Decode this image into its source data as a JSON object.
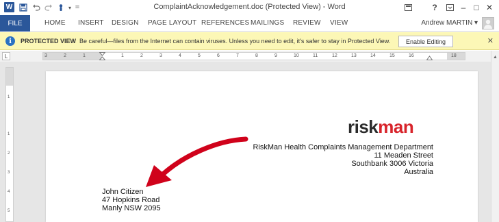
{
  "window": {
    "title": "ComplaintAcknowledgement.doc (Protected View) - Word",
    "app_icon_letter": "W",
    "help": "?",
    "minimize": "–",
    "restore": "□",
    "close": "✕"
  },
  "quick_access": {
    "save_icon": "save-icon",
    "undo_icon": "undo-icon",
    "redo_icon": "redo-icon",
    "customize": "="
  },
  "ribbon": {
    "file_label": "FILE",
    "tabs": [
      "HOME",
      "INSERT",
      "DESIGN",
      "PAGE LAYOUT",
      "REFERENCES",
      "MAILINGS",
      "REVIEW",
      "VIEW"
    ],
    "user_name": "Andrew MARTIN"
  },
  "protected_view": {
    "title": "PROTECTED VIEW",
    "message": "Be careful—files from the Internet can contain viruses. Unless you need to edit, it's safer to stay in Protected View.",
    "enable_button": "Enable Editing",
    "close": "✕"
  },
  "ruler": {
    "corner": "L",
    "h_numbers": [
      "3",
      "2",
      "1",
      "1",
      "2",
      "3",
      "4",
      "5",
      "6",
      "7",
      "8",
      "9",
      "10",
      "11",
      "12",
      "13",
      "14",
      "15",
      "16",
      "18"
    ],
    "v_numbers": [
      "1",
      "1",
      "2",
      "3",
      "4",
      "5"
    ]
  },
  "document": {
    "logo_risk": "risk",
    "logo_man": "man",
    "sender_lines": [
      "RiskMan Health Complaints Management Department",
      "11 Meaden Street",
      "Southbank 3006 Victoria",
      "Australia"
    ],
    "recipient_lines": [
      "John Citizen",
      "47 Hopkins Road",
      "Manly NSW 2095"
    ]
  },
  "colors": {
    "word_blue": "#2b579a",
    "banner_yellow": "#fcf7b6",
    "brand_red": "#d8232a",
    "arrow_red": "#d0021b"
  }
}
